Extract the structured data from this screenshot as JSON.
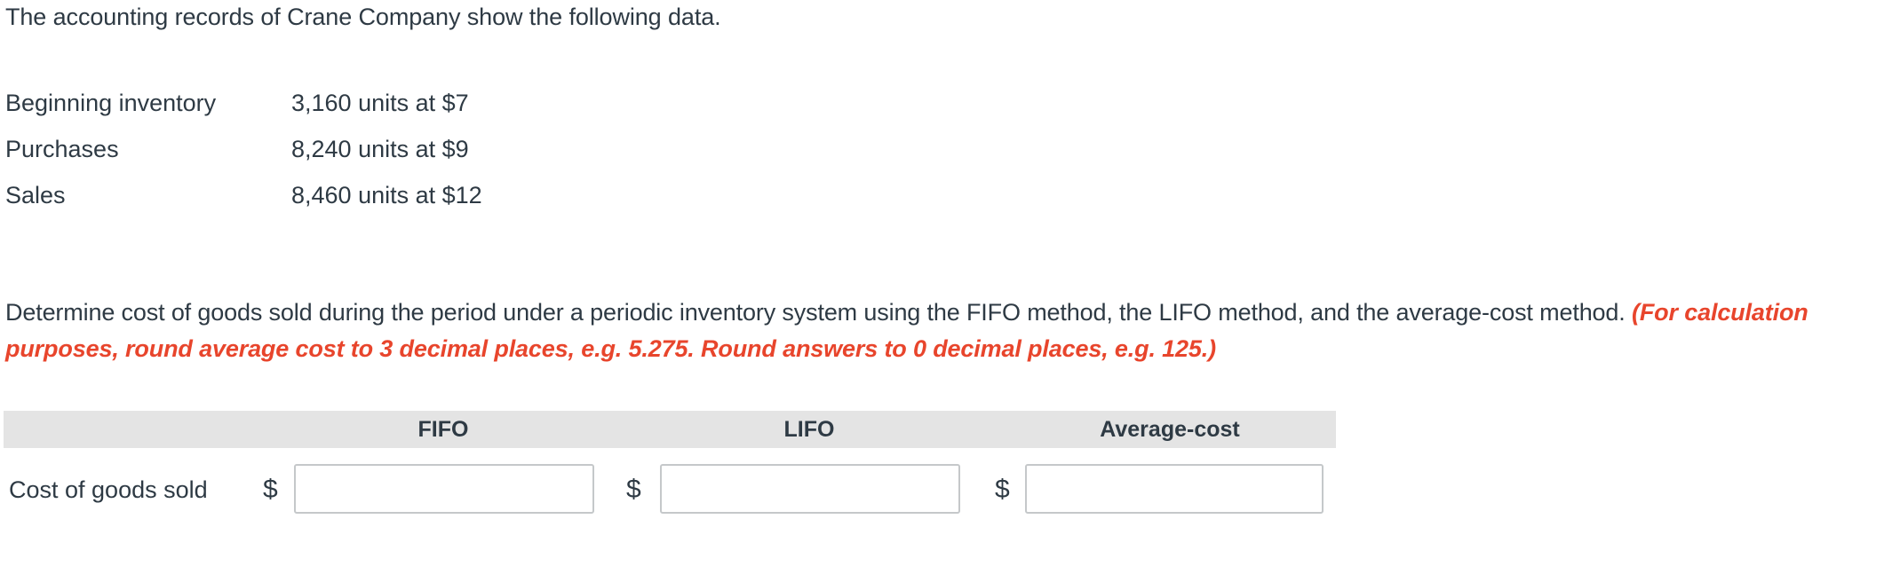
{
  "intro": {
    "text": "The accounting records of Crane Company show the following data."
  },
  "facts": {
    "rows": [
      {
        "label": "Beginning inventory",
        "value": "3,160 units at $7"
      },
      {
        "label": "Purchases",
        "value": "8,240 units at $9"
      },
      {
        "label": "Sales",
        "value": "8,460 units at $12"
      }
    ]
  },
  "instruction": {
    "main": "Determine cost of goods sold during the period under a periodic inventory system using the FIFO method, the LIFO method, and the average-cost method. ",
    "note": "(For calculation purposes, round average cost to 3 decimal places, e.g. 5.275. Round answers to 0 decimal places, e.g. 125.)",
    "note_color": "#e8452c"
  },
  "answer_table": {
    "header_bg": "#e4e4e4",
    "headers": [
      "FIFO",
      "LIFO",
      "Average-cost"
    ],
    "row_label": "Cost of goods sold",
    "currency_symbols": [
      "$",
      "$",
      "$"
    ],
    "inputs": [
      {
        "value": "",
        "placeholder": ""
      },
      {
        "value": "",
        "placeholder": ""
      },
      {
        "value": "",
        "placeholder": ""
      }
    ]
  }
}
